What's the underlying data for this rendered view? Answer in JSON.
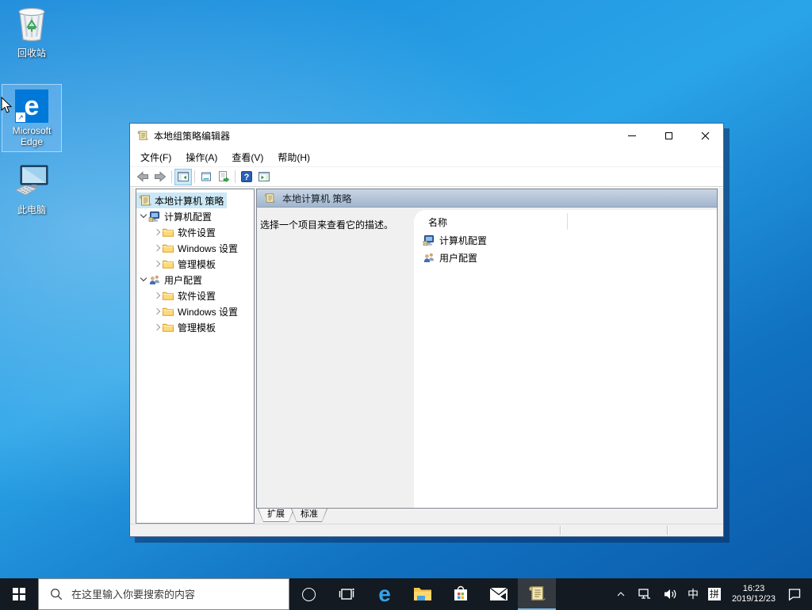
{
  "desktop": {
    "icons": [
      {
        "label": "回收站"
      },
      {
        "label": "Microsoft Edge",
        "selected": true
      },
      {
        "label": "此电脑"
      }
    ]
  },
  "icons": {
    "edge_glyph": "e",
    "shortcut_arrow": "↗"
  },
  "window": {
    "title": "本地组策略编辑器",
    "menus": [
      "文件(F)",
      "操作(A)",
      "查看(V)",
      "帮助(H)"
    ],
    "tree": {
      "items": [
        {
          "label": "本地计算机 策略"
        },
        {
          "label": "计算机配置"
        },
        {
          "label": "软件设置"
        },
        {
          "label": "Windows 设置"
        },
        {
          "label": "管理模板"
        },
        {
          "label": "用户配置"
        },
        {
          "label": "软件设置"
        },
        {
          "label": "Windows 设置"
        },
        {
          "label": "管理模板"
        }
      ]
    },
    "main": {
      "header": "本地计算机 策略",
      "description": "选择一个项目来查看它的描述。",
      "list": {
        "column_header": "名称",
        "items": [
          {
            "label": "计算机配置"
          },
          {
            "label": "用户配置"
          }
        ]
      },
      "tabs": [
        {
          "label": "扩展"
        },
        {
          "label": "标准"
        }
      ]
    }
  },
  "taskbar": {
    "search_placeholder": "在这里输入你要搜索的内容",
    "tray": {
      "ime_language": "中",
      "ime_mode": "拼",
      "time": "16:23",
      "date": "2019/12/23"
    }
  },
  "colors": {
    "accent": "#0078d7",
    "selection": "#cbe8f6",
    "taskbar": "#131a21"
  }
}
